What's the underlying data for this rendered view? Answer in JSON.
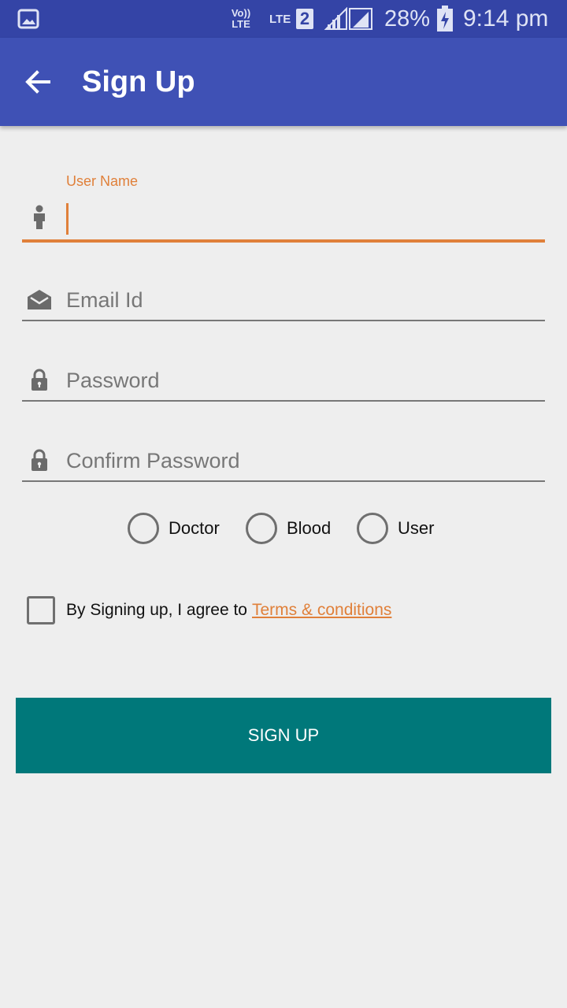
{
  "status_bar": {
    "volte": "Vo)) LTE",
    "lte": "LTE",
    "sim": "2",
    "battery_percent": "28%",
    "time": "9:14 pm",
    "icons": [
      "gallery-notification-icon",
      "volte-icon",
      "lte-data-icon",
      "signal-strength-icon",
      "battery-charging-icon"
    ]
  },
  "app_bar": {
    "title": "Sign Up",
    "back_icon": "arrow-back-icon"
  },
  "form": {
    "username": {
      "label": "User Name",
      "value": "",
      "icon": "person-icon",
      "focused": true
    },
    "email": {
      "placeholder": "Email Id",
      "value": "",
      "icon": "envelope-open-icon"
    },
    "password": {
      "placeholder": "Password",
      "value": "",
      "icon": "lock-icon"
    },
    "confirm_password": {
      "placeholder": "Confirm Password",
      "value": "",
      "icon": "lock-icon"
    }
  },
  "role_options": [
    "Doctor",
    "Blood",
    "User"
  ],
  "role_selected": null,
  "terms": {
    "text": "By Signing up, I agree to",
    "link": "Terms & conditions",
    "checked": false
  },
  "submit": {
    "label": "SIGN UP"
  },
  "colors": {
    "status_bar": "#3444a6",
    "app_bar": "#3f51b5",
    "accent": "#e0803a",
    "button": "#00787a",
    "background": "#eeeeee"
  }
}
